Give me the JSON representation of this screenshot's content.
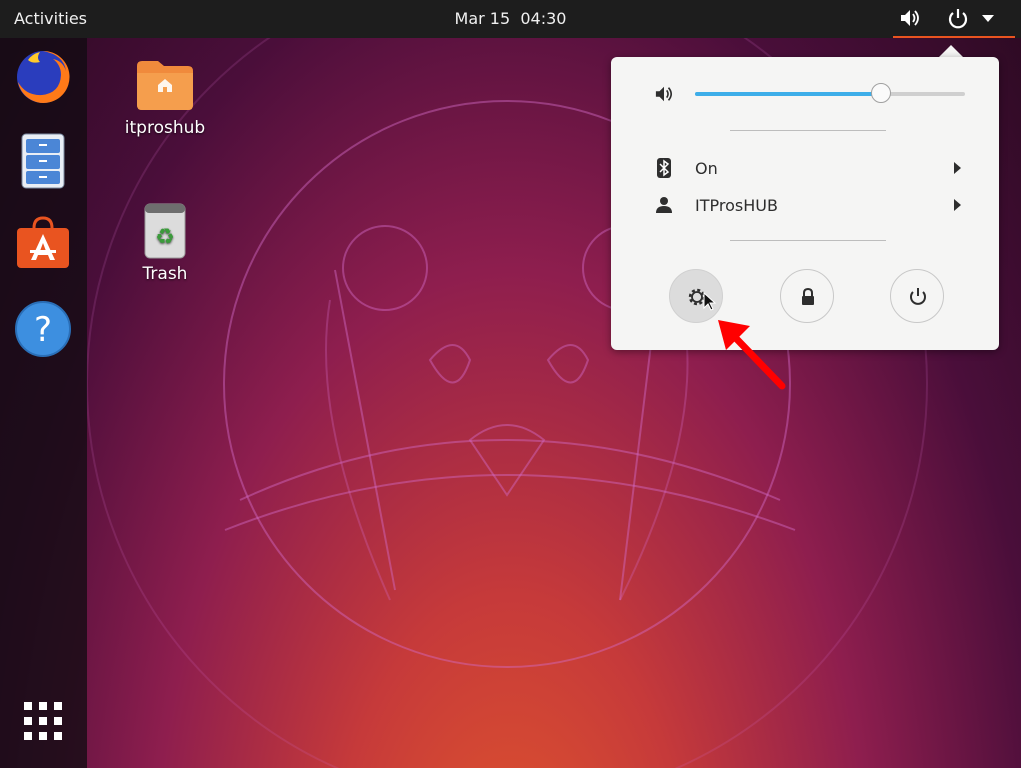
{
  "topbar": {
    "activities_label": "Activities",
    "clock": "Mar 15  04:30",
    "tray_icons": [
      "speaker-icon",
      "power-icon",
      "chevron-down-icon"
    ]
  },
  "dock": {
    "items": [
      {
        "name": "firefox",
        "icon": "firefox-icon"
      },
      {
        "name": "files",
        "icon": "file-cabinet-icon"
      },
      {
        "name": "software",
        "icon": "shopping-bag-icon"
      },
      {
        "name": "help",
        "icon": "help-icon"
      }
    ],
    "show_apps_icon": "grid-icon"
  },
  "desktop": {
    "icons": [
      {
        "label": "itproshub",
        "icon": "home-folder-icon"
      },
      {
        "label": "Trash",
        "icon": "trash-icon"
      }
    ]
  },
  "system_menu": {
    "volume_level": 0.69,
    "bluetooth": {
      "label": "On",
      "icon": "bluetooth-icon"
    },
    "user": {
      "label": "ITProsHUB",
      "icon": "user-icon"
    },
    "buttons": [
      {
        "name": "settings",
        "icon": "gear-icon"
      },
      {
        "name": "lock",
        "icon": "lock-icon"
      },
      {
        "name": "power-off",
        "icon": "power-icon"
      }
    ]
  },
  "colors": {
    "accent": "#e95420",
    "slider_fill": "#3daee9",
    "topbar_bg": "#1d1d1d",
    "menu_bg": "#f5f5f4",
    "annotation_arrow": "#ff0000"
  }
}
